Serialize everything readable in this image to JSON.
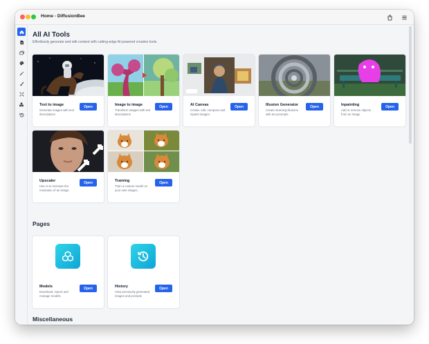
{
  "window": {
    "title": "Home - DiffusionBee"
  },
  "titlebar_icons": [
    "bag-icon",
    "menu-icon"
  ],
  "sidebar": {
    "items": [
      {
        "name": "home",
        "icon": "house-icon",
        "active": true
      },
      {
        "name": "text-to-image",
        "icon": "document-icon",
        "active": false
      },
      {
        "name": "image-to-image",
        "icon": "images-icon",
        "active": false
      },
      {
        "name": "ai-canvas",
        "icon": "palette-icon",
        "active": false
      },
      {
        "name": "illusion",
        "icon": "magic-wand-icon",
        "active": false
      },
      {
        "name": "inpainting",
        "icon": "brush-icon",
        "active": false
      },
      {
        "name": "upscaler",
        "icon": "expand-icon",
        "active": false
      },
      {
        "name": "models",
        "icon": "cubes-icon",
        "active": false
      },
      {
        "name": "history",
        "icon": "history-icon",
        "active": false
      }
    ]
  },
  "main": {
    "title": "All AI Tools",
    "subtitle": "Effortlessly generate and edit content with cutting-edge AI-powered creative tools.",
    "tools": [
      {
        "title": "Text to image",
        "desc": "Generate images with text descriptions",
        "button": "Open"
      },
      {
        "title": "Image to image",
        "desc": "Transform images with text descriptions",
        "button": "Open"
      },
      {
        "title": "AI Canvas",
        "desc": "Create, edit, compose and inpaint images.",
        "button": "Open"
      },
      {
        "title": "Illusion Generator",
        "desc": "Create stunning illusions with text prompts",
        "button": "Open"
      },
      {
        "title": "Inpainting",
        "desc": "Add or remove objects from an image",
        "button": "Open"
      },
      {
        "title": "Upscaler",
        "desc": "Use AI to increase the resolution of an image.",
        "button": "Open"
      },
      {
        "title": "Training",
        "desc": "Train a custom model on your own images.",
        "button": "Open"
      }
    ],
    "pages_title": "Pages",
    "pages": [
      {
        "title": "Models",
        "desc": "Download, import and manage models",
        "button": "Open",
        "icon": "cubes-icon"
      },
      {
        "title": "History",
        "desc": "View previously generated images and prompts",
        "button": "Open",
        "icon": "history-icon"
      }
    ],
    "misc_title": "Miscellaneous"
  },
  "colors": {
    "accent": "#2563eb",
    "page_icon_start": "#2fd4e8",
    "page_icon_end": "#0ea5d6"
  }
}
